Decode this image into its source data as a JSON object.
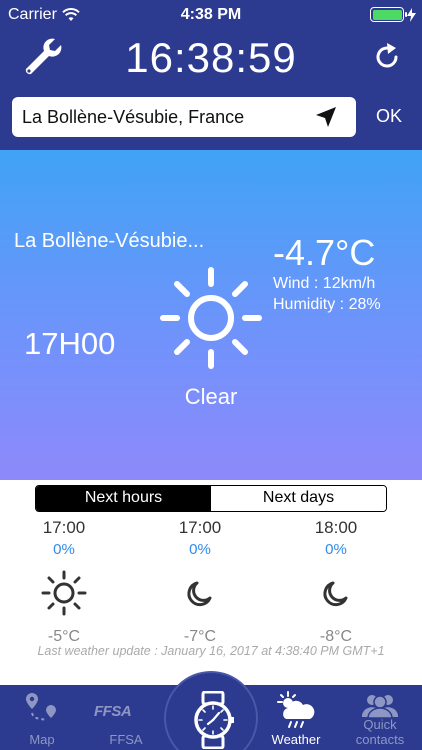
{
  "status": {
    "carrier": "Carrier",
    "time": "4:38 PM"
  },
  "header": {
    "clock": "16:38:59"
  },
  "search": {
    "value": "La Bollène-Vésubie, France",
    "ok_label": "OK"
  },
  "current": {
    "place": "La Bollène-Vésubie...",
    "hour": "17H00",
    "condition": "Clear",
    "temperature": "-4.7°C",
    "wind": "Wind : 12km/h",
    "humidity": "Humidity : 28%"
  },
  "segments": {
    "next_hours": "Next hours",
    "next_days": "Next days",
    "selected": "next_hours"
  },
  "forecast": [
    {
      "time": "17:00",
      "precip": "0%",
      "icon": "sun-icon",
      "temp": "-5°C"
    },
    {
      "time": "17:00",
      "precip": "0%",
      "icon": "moon-icon",
      "temp": "-7°C"
    },
    {
      "time": "18:00",
      "precip": "0%",
      "icon": "moon-icon",
      "temp": "-8°C"
    }
  ],
  "last_update": "Last weather update : January 16, 2017 at 4:38:40 PM GMT+1",
  "tabs": [
    {
      "label": "Map",
      "icon": "map-icon"
    },
    {
      "label": "FFSA",
      "icon": "ffsa-logo",
      "logo_text": "FFSA"
    },
    {
      "label": "",
      "icon": "watch-icon"
    },
    {
      "label": "Weather",
      "icon": "weather-icon",
      "active": true
    },
    {
      "label": "Quick contacts",
      "icon": "contacts-icon"
    }
  ],
  "colors": {
    "navy": "#2c3a8f",
    "accent_blue": "#2f8bea",
    "battery": "#4cd964"
  }
}
